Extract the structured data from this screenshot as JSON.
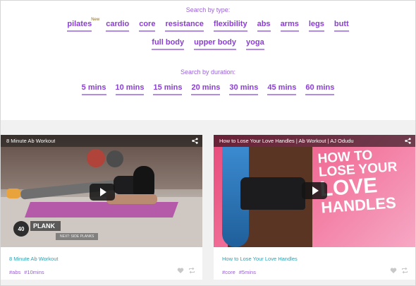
{
  "type_filter": {
    "label": "Search by type:",
    "row1": [
      "pilates",
      "cardio",
      "core",
      "resistance",
      "flexibility",
      "abs",
      "arms",
      "legs",
      "butt"
    ],
    "row2": [
      "full body",
      "upper body",
      "yoga"
    ],
    "new_badge": "New"
  },
  "duration_filter": {
    "label": "Search by duration:",
    "options": [
      "5 mins",
      "10 mins",
      "15 mins",
      "20 mins",
      "30 mins",
      "45 mins",
      "60 mins"
    ]
  },
  "cards": [
    {
      "video_title": "8 Minute Ab Workout",
      "title": "8 Minute Ab Workout",
      "tags": [
        "#abs",
        "#10mins"
      ],
      "overlay": {
        "badge": "40",
        "label": "PLANK",
        "next": "NEXT: SIDE PLANKS"
      }
    },
    {
      "video_title": "How to Lose Your Love Handles | Ab Workout | AJ Odudu",
      "title": "How to Lose Your Love Handles",
      "tags": [
        "#core",
        "#5mins"
      ],
      "headline": [
        "HOW TO",
        "LOSE YOUR",
        "LOVE",
        "HANDLES"
      ]
    }
  ],
  "colors": {
    "accent_purple": "#8a3fd0",
    "label_purple": "#9a63d6",
    "link_teal": "#2aa2b4",
    "band_gray": "#f1f1f1"
  },
  "icons": [
    "share-icon",
    "play-icon",
    "heart-icon",
    "repeat-icon"
  ]
}
